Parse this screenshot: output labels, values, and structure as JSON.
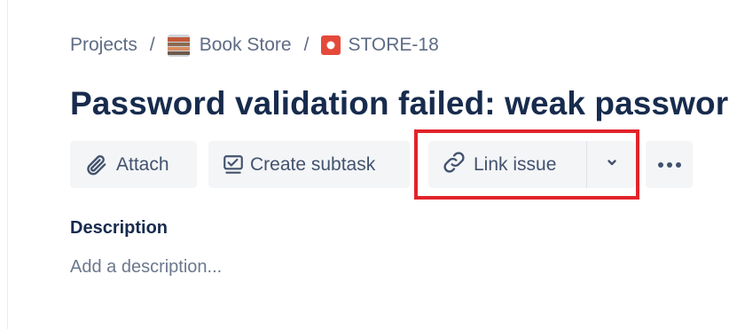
{
  "breadcrumb": {
    "projects_label": "Projects",
    "separator": "/",
    "project_name": "Book Store",
    "issue_key": "STORE-18"
  },
  "issue": {
    "title": "Password validation failed: weak password"
  },
  "toolbar": {
    "attach_label": "Attach",
    "create_subtask_label": "Create subtask",
    "link_issue_label": "Link issue"
  },
  "description": {
    "heading": "Description",
    "placeholder": "Add a description..."
  },
  "icons": {
    "attach": "paperclip-icon",
    "create_subtask": "subtask-icon",
    "link_issue": "link-icon",
    "link_dropdown": "chevron-down-icon",
    "more": "more-horizontal-icon",
    "project_avatar": "project-avatar-icon",
    "issue_type": "bug-issue-type-icon"
  },
  "colors": {
    "text_primary": "#172b4d",
    "text_subtle": "#5e6c84",
    "button_bg": "#f4f5f7",
    "issue_type_red": "#e5493a",
    "highlight_red": "#e2232a"
  }
}
